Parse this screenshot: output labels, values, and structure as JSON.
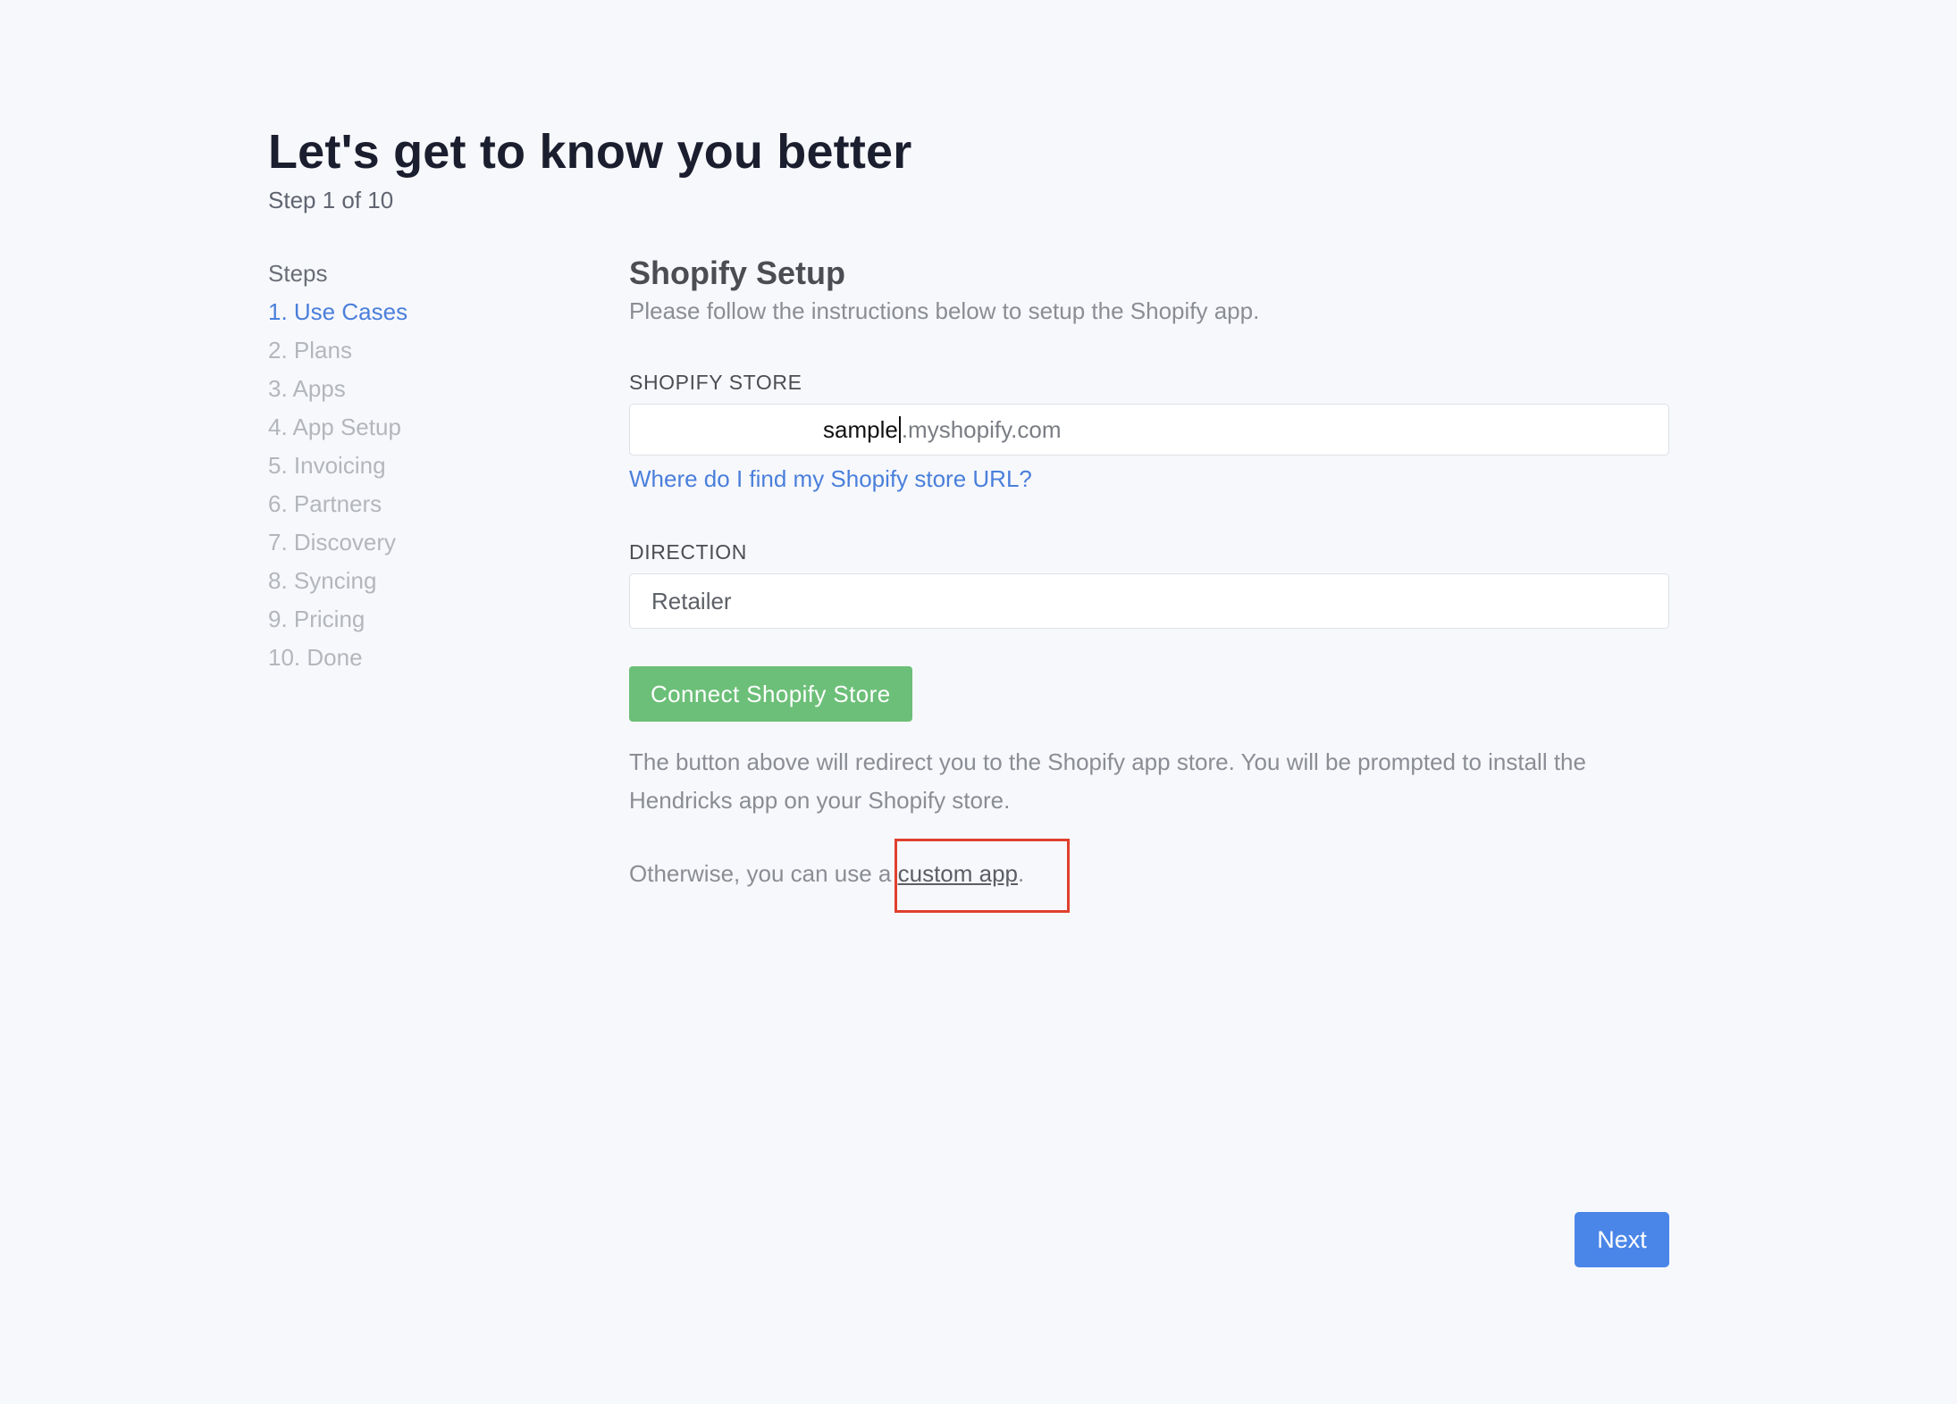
{
  "header": {
    "title": "Let's get to know you better",
    "subtitle": "Step 1 of 10"
  },
  "steps": {
    "heading": "Steps",
    "items": [
      {
        "label": "1. Use Cases",
        "active": true
      },
      {
        "label": "2. Plans",
        "active": false
      },
      {
        "label": "3. Apps",
        "active": false
      },
      {
        "label": "4. App Setup",
        "active": false
      },
      {
        "label": "5. Invoicing",
        "active": false
      },
      {
        "label": "6. Partners",
        "active": false
      },
      {
        "label": "7. Discovery",
        "active": false
      },
      {
        "label": "8. Syncing",
        "active": false
      },
      {
        "label": "9. Pricing",
        "active": false
      },
      {
        "label": "10. Done",
        "active": false
      }
    ]
  },
  "main": {
    "title": "Shopify Setup",
    "description": "Please follow the instructions below to setup the Shopify app.",
    "store": {
      "label": "SHOPIFY STORE",
      "value": "sample",
      "suffix": ".myshopify.com",
      "help_link": "Where do I find my Shopify store URL?"
    },
    "direction": {
      "label": "DIRECTION",
      "value": "Retailer"
    },
    "connect_label": "Connect Shopify Store",
    "redirect_note": "The button above will redirect you to the Shopify app store. You will be prompted to install the Hendricks app on your Shopify store.",
    "otherwise_prefix": "Otherwise, you can use a ",
    "custom_app_link": "custom app",
    "otherwise_suffix": "."
  },
  "footer": {
    "next_label": "Next"
  },
  "colors": {
    "accent": "#4a7fdb",
    "success": "#6cbf78",
    "primary_button": "#4a86e8",
    "highlight": "#e0402e"
  }
}
